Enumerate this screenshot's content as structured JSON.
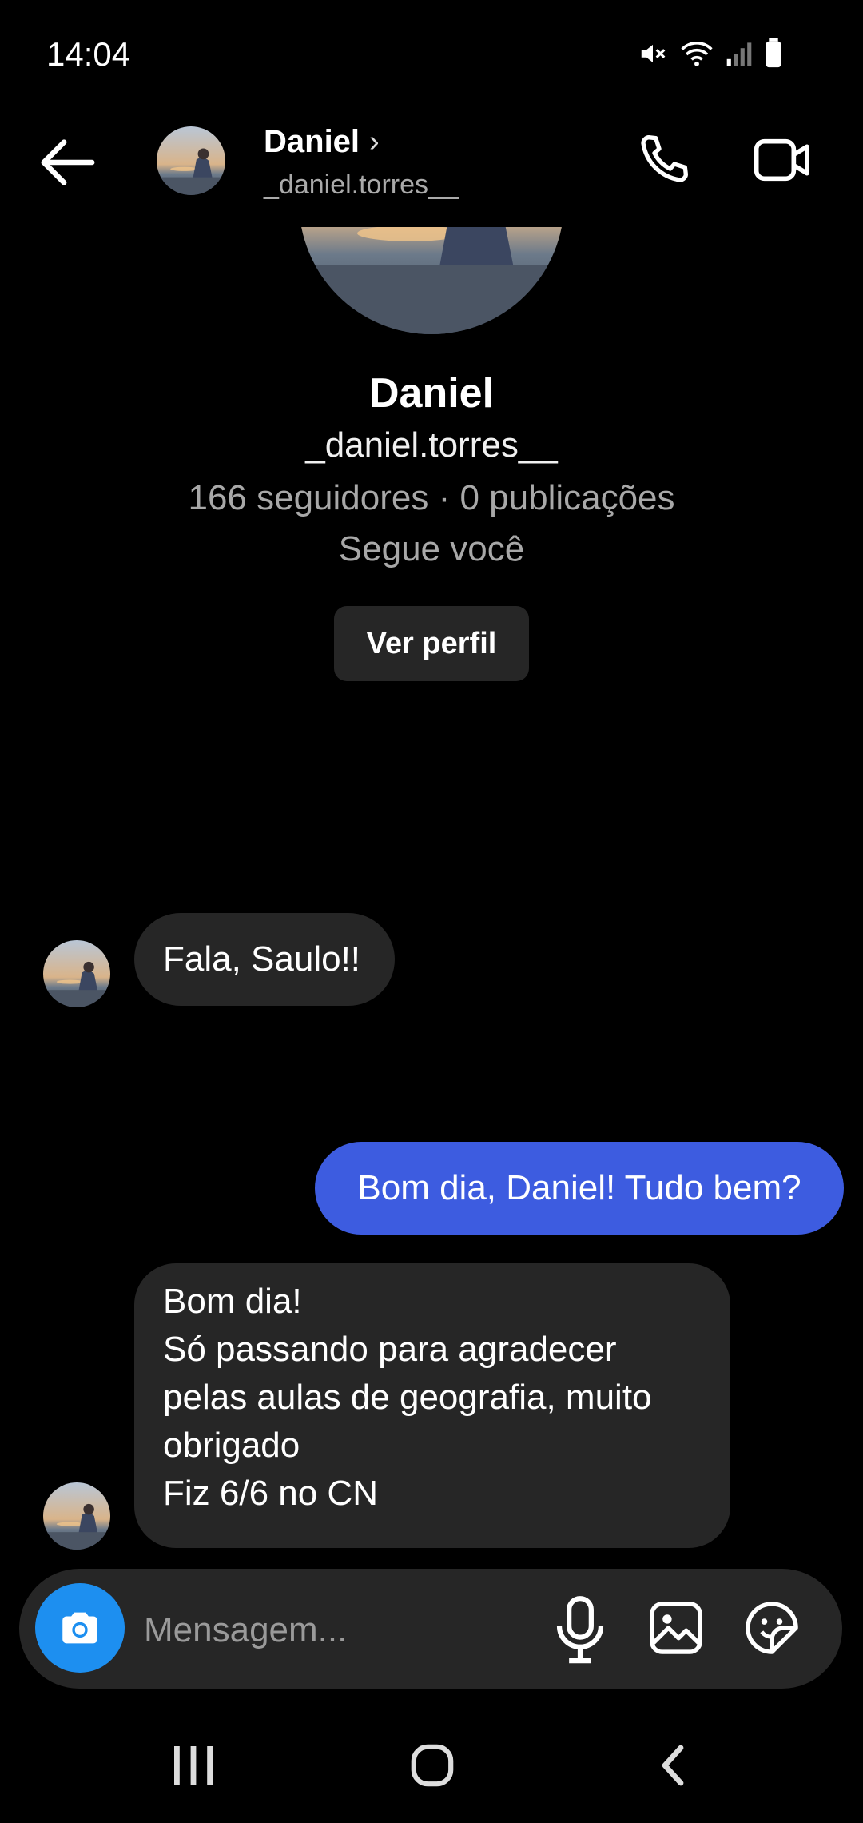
{
  "status_bar": {
    "time": "14:04"
  },
  "header": {
    "name": "Daniel",
    "chevron": "›",
    "handle": "_daniel.torres__",
    "icons": [
      "back-arrow-icon",
      "phone-icon",
      "video-camera-icon"
    ]
  },
  "profile": {
    "name": "Daniel",
    "handle": "_daniel.torres__",
    "stats": "166 seguidores · 0 publicações",
    "follow_status": "Segue você",
    "view_profile_label": "Ver perfil"
  },
  "messages": [
    {
      "from": "them",
      "text": "Fala, Saulo!!"
    },
    {
      "from": "me",
      "text": "Bom dia, Daniel! Tudo bem?"
    },
    {
      "from": "them",
      "lines": [
        "Bom dia!",
        "Só passando para agradecer",
        "pelas aulas de geografia, muito",
        "obrigado",
        "Fiz 6/6 no CN"
      ]
    }
  ],
  "composer": {
    "placeholder": "Mensagem...",
    "icons": [
      "camera-icon",
      "microphone-icon",
      "gallery-icon",
      "sticker-icon"
    ]
  },
  "colors": {
    "background": "#000000",
    "incoming_bubble": "#262626",
    "outgoing_bubble": "#3d5ce0",
    "camera_button": "#1d8ff0",
    "secondary_text": "#a8a8a8"
  }
}
